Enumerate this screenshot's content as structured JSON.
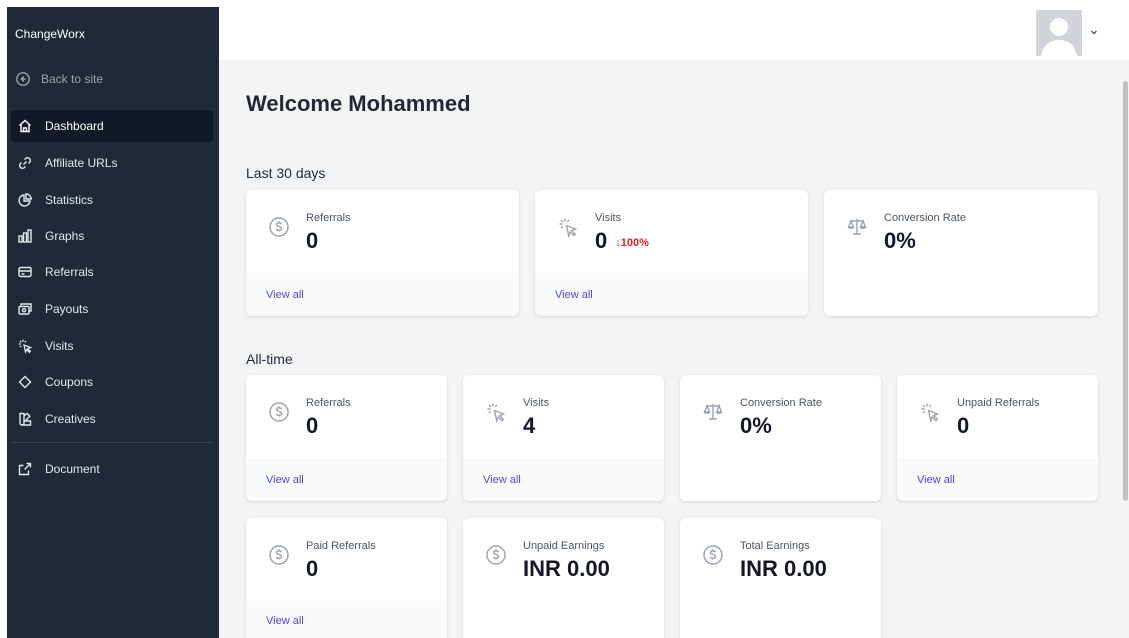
{
  "app": {
    "brand": "ChangeWorx",
    "back_label": "Back to site"
  },
  "sidebar": {
    "items": [
      {
        "label": "Dashboard",
        "icon": "home-icon",
        "active": true
      },
      {
        "label": "Affiliate URLs",
        "icon": "link-icon"
      },
      {
        "label": "Statistics",
        "icon": "pie-chart-icon"
      },
      {
        "label": "Graphs",
        "icon": "bar-chart-icon"
      },
      {
        "label": "Referrals",
        "icon": "credit-card-icon"
      },
      {
        "label": "Payouts",
        "icon": "cash-icon"
      },
      {
        "label": "Visits",
        "icon": "cursor-click-icon"
      },
      {
        "label": "Coupons",
        "icon": "tag-icon"
      },
      {
        "label": "Creatives",
        "icon": "color-swatch-icon"
      },
      {
        "label": "Document",
        "icon": "external-link-icon"
      }
    ]
  },
  "main": {
    "welcome": "Welcome Mohammed",
    "last30": {
      "heading": "Last 30 days",
      "cards": [
        {
          "label": "Referrals",
          "value": "0",
          "icon": "dollar-circle-icon",
          "link": "View all"
        },
        {
          "label": "Visits",
          "value": "0",
          "icon": "cursor-click-icon",
          "link": "View all",
          "delta": "100%",
          "delta_direction": "down"
        },
        {
          "label": "Conversion Rate",
          "value": "0%",
          "icon": "scale-icon"
        }
      ]
    },
    "alltime": {
      "heading": "All-time",
      "cards": [
        {
          "label": "Referrals",
          "value": "0",
          "icon": "dollar-circle-icon",
          "link": "View all"
        },
        {
          "label": "Visits",
          "value": "4",
          "icon": "cursor-click-icon",
          "link": "View all"
        },
        {
          "label": "Conversion Rate",
          "value": "0%",
          "icon": "scale-icon"
        },
        {
          "label": "Unpaid Referrals",
          "value": "0",
          "icon": "cursor-click-icon",
          "link": "View all"
        },
        {
          "label": "Paid Referrals",
          "value": "0",
          "icon": "dollar-circle-icon",
          "link": "View all"
        },
        {
          "label": "Unpaid Earnings",
          "value": "INR 0.00",
          "icon": "dollar-circle-icon"
        },
        {
          "label": "Total Earnings",
          "value": "INR 0.00",
          "icon": "dollar-circle-icon"
        }
      ]
    }
  },
  "colors": {
    "sidebar_bg": "#1f2937",
    "link": "#4f46e5",
    "delta_negative": "#dc2626",
    "page_bg": "#f3f4f6"
  }
}
